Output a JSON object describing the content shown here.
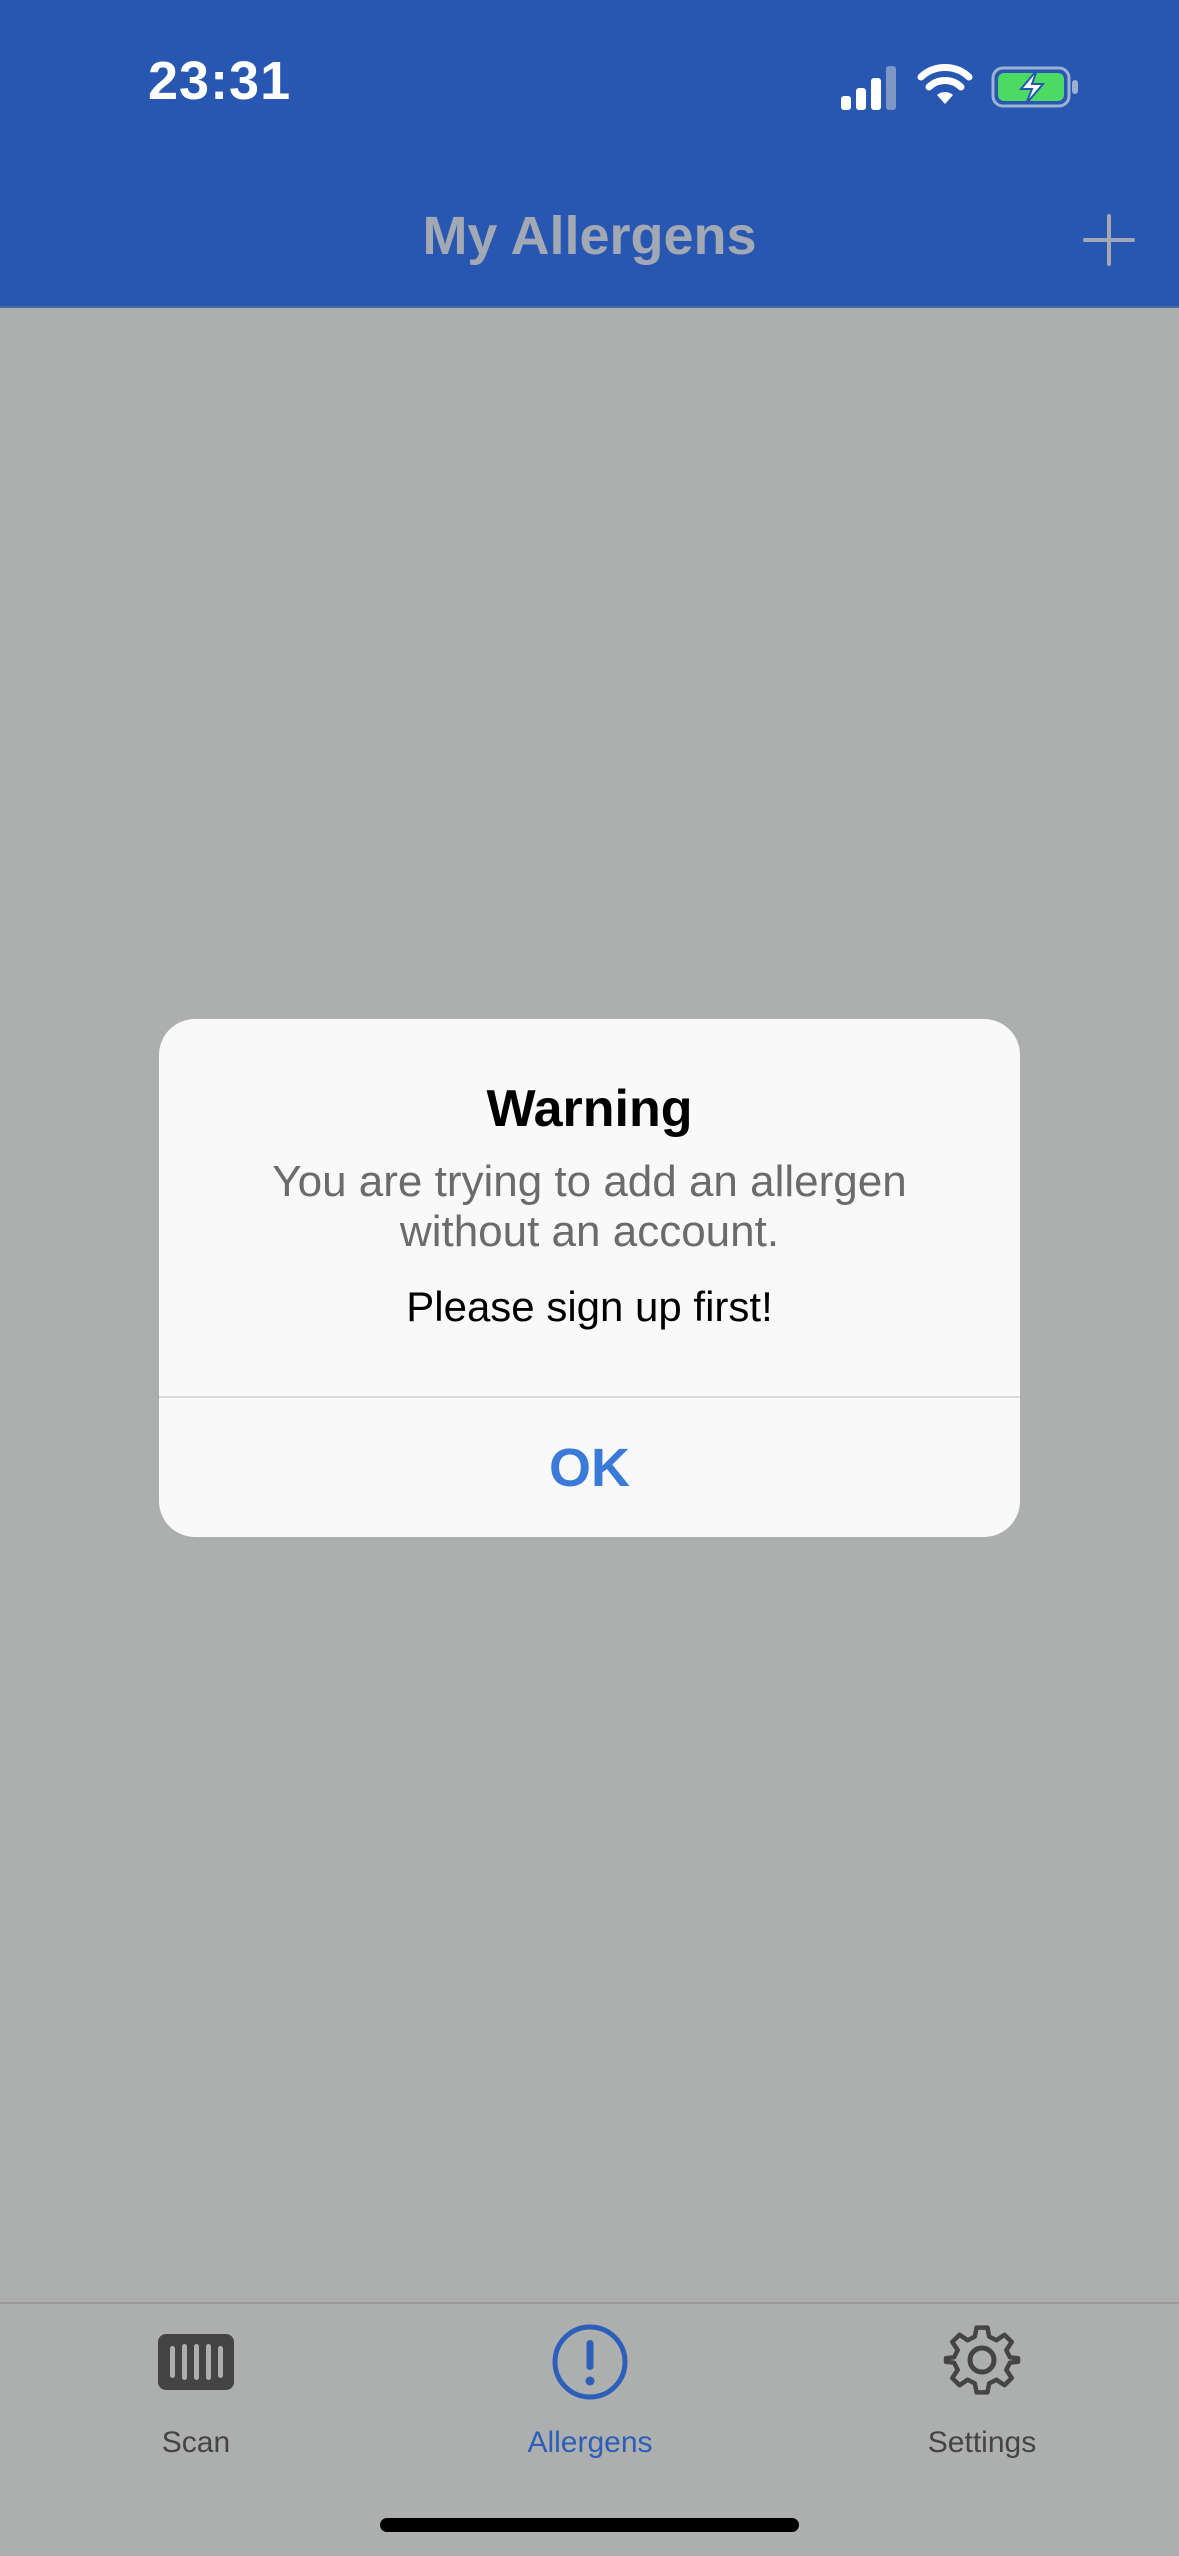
{
  "status_bar": {
    "time": "23:31",
    "icons": [
      "signal-icon",
      "wifi-icon",
      "battery-charging-icon"
    ]
  },
  "nav": {
    "title": "My Allergens",
    "add_icon": "plus-icon"
  },
  "alert": {
    "title": "Warning",
    "message": "You are trying to add an allergen without an account.",
    "instruction": "Please sign up first!",
    "ok_label": "OK"
  },
  "tabbar": {
    "tabs": [
      {
        "label": "Scan",
        "icon": "barcode-icon",
        "active": false
      },
      {
        "label": "Allergens",
        "icon": "exclamation-circle-icon",
        "active": true
      },
      {
        "label": "Settings",
        "icon": "gear-icon",
        "active": false
      }
    ]
  },
  "colors": {
    "header": "#2757b0",
    "overlay": "#adaeae",
    "accent": "#3a7bd9",
    "active_tab": "#2b5fb9"
  }
}
